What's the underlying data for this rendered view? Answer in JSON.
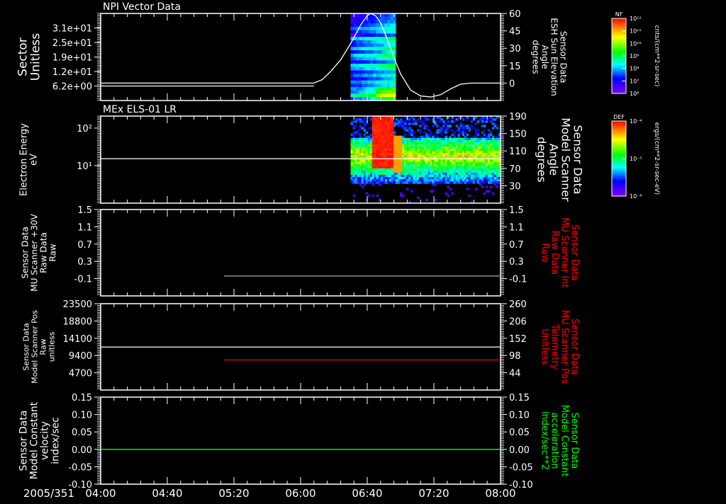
{
  "chart_data": {
    "type": "multi-panel time series / spectrogram",
    "date_label": "2005/351",
    "x_ticks": [
      "04:00",
      "04:40",
      "05:20",
      "06:00",
      "06:40",
      "07:20",
      "08:00"
    ],
    "x_range_minutes_from_0400": [
      0,
      240
    ],
    "panels": [
      {
        "title": "NPI Vector Data",
        "type": "spectrogram+line",
        "left_label": [
          "Sector",
          "Unitless"
        ],
        "left_range": [
          0,
          37.2
        ],
        "left_ticks": [
          "3.1e+01",
          "2.5e+01",
          "1.9e+01",
          "1.2e+01",
          "6.2e+00"
        ],
        "left_tick_values": [
          31,
          24.8,
          18.6,
          12.4,
          6.2
        ],
        "right_label": [
          "Sensor Data",
          "ESH Sun Elevation",
          "Angle",
          "degrees"
        ],
        "right_label_color": "#ffffff",
        "right_range": [
          -15,
          60
        ],
        "right_ticks": [
          "60",
          "45",
          "30",
          "15",
          "0"
        ],
        "right_tick_values": [
          60,
          45,
          30,
          15,
          0
        ],
        "spectrogram_time_range": [
          150,
          177
        ],
        "line_series": {
          "name": "ESH Sun Elevation",
          "color": "#ffffff",
          "x": [
            0,
            128,
            133,
            138,
            144,
            150,
            156,
            160,
            162,
            165,
            168,
            172,
            176,
            180,
            186,
            192,
            198,
            204,
            210,
            216,
            222,
            240
          ],
          "y": [
            0,
            0,
            3,
            10,
            20,
            34,
            50,
            58,
            60,
            58,
            52,
            38,
            22,
            8,
            -6,
            -11,
            -12,
            -10,
            -5,
            -1,
            0,
            0
          ]
        },
        "colorbar": {
          "label": "NF",
          "units": "cnts/(cm**2-sr-sec)",
          "ticks": [
            "10¹²",
            "10¹¹",
            "10¹⁰",
            "10⁹",
            "10⁸",
            "10⁷",
            "10⁶"
          ]
        }
      },
      {
        "title": "MEx ELS-01 LR",
        "type": "spectrogram+line",
        "left_label": [
          "Electron Energy",
          "eV"
        ],
        "left_scale": "log",
        "left_range_log10": [
          0,
          2.32
        ],
        "left_ticks": [
          "10²",
          "10¹"
        ],
        "left_tick_values_log10": [
          2,
          1
        ],
        "right_label": [
          "Sensor Data",
          "Model Scanner",
          "Angle",
          "degrees"
        ],
        "right_label_color": "#ffffff",
        "right_range": [
          -10,
          190
        ],
        "right_ticks": [
          "190",
          "150",
          "110",
          "70",
          "30"
        ],
        "right_tick_values": [
          190,
          150,
          110,
          70,
          30
        ],
        "spectrogram_time_range": [
          150,
          240
        ],
        "line_series": {
          "name": "Model Scanner Angle",
          "color": "#ffffff",
          "x": [
            0,
            240
          ],
          "y": [
            92,
            92
          ]
        },
        "colorbar": {
          "label": "DEF",
          "units": "ergs/(cm**2-sr-sec-eV)",
          "ticks": [
            "10⁻⁴",
            "10⁻⁵",
            "10⁻⁶"
          ]
        }
      },
      {
        "title": "",
        "type": "line",
        "left_label": [
          "Sensor Data",
          "MU Scanner +30V",
          "Raw Data",
          "Raw"
        ],
        "left_range": [
          -0.5,
          1.5
        ],
        "left_ticks": [
          "1.5",
          "1.1",
          "0.7",
          "0.3",
          "-0.1"
        ],
        "left_tick_values": [
          1.5,
          1.1,
          0.7,
          0.3,
          -0.1
        ],
        "right_label": [
          "Sensor Data",
          "MU Scanner Int",
          "Raw Data",
          "Raw"
        ],
        "right_label_color": "#ff0000",
        "right_range": [
          -0.5,
          1.5
        ],
        "right_ticks": [
          "1.5",
          "1.1",
          "0.7",
          "0.3",
          "-0.1"
        ],
        "right_tick_values": [
          1.5,
          1.1,
          0.7,
          0.3,
          -0.1
        ],
        "line_series": {
          "name": "MU Scanner Int",
          "color": "#808080",
          "x": [
            74,
            240
          ],
          "y": [
            -0.04,
            -0.04
          ]
        }
      },
      {
        "title": "",
        "type": "line",
        "left_label": [
          "Sensor Data",
          "Model Scanner Pos",
          "Raw",
          "unitless"
        ],
        "left_range": [
          0,
          23500
        ],
        "left_ticks": [
          "23500",
          "18800",
          "14100",
          "9400",
          "4700"
        ],
        "left_tick_values": [
          23500,
          18800,
          14100,
          9400,
          4700
        ],
        "right_label": [
          "Sensor Data",
          "MU Scanner Pos",
          "Telemetry",
          "Unitless"
        ],
        "right_label_color": "#ff0000",
        "right_range": [
          -10,
          260
        ],
        "right_ticks": [
          "260",
          "206",
          "152",
          "98",
          "44"
        ],
        "right_tick_values": [
          260,
          206,
          152,
          98,
          44
        ],
        "line_series": {
          "name": "Model Scanner Pos",
          "color": "#ffffff",
          "x": [
            0,
            240
          ],
          "y": [
            11700,
            11700
          ]
        },
        "line_series_right": {
          "name": "MU Scanner Pos",
          "color": "#ff0000",
          "x": [
            74,
            240
          ],
          "y": [
            84,
            84
          ]
        }
      },
      {
        "title": "",
        "type": "line",
        "left_label": [
          "Sensor Data",
          "Model Constant",
          "velocity",
          "index/sec"
        ],
        "left_range": [
          -0.1,
          0.15
        ],
        "left_ticks": [
          "0.15",
          "0.10",
          "0.05",
          "0.00",
          "-0.05",
          "-0.10"
        ],
        "left_tick_values": [
          0.15,
          0.1,
          0.05,
          0.0,
          -0.05,
          -0.1
        ],
        "right_label": [
          "Sensor Data",
          "Model Constant",
          "acceleration",
          "index/sec**2"
        ],
        "right_label_color": "#00ff00",
        "right_range": [
          -0.1,
          0.15
        ],
        "right_ticks": [
          "0.15",
          "0.10",
          "0.05",
          "0.00",
          "-0.05",
          "-0.10"
        ],
        "right_tick_values": [
          0.15,
          0.1,
          0.05,
          0.0,
          -0.05,
          -0.1
        ],
        "line_series": {
          "name": "Model Constant velocity",
          "color": "#00ff00",
          "x": [
            0,
            240
          ],
          "y": [
            0,
            0
          ]
        }
      }
    ]
  }
}
